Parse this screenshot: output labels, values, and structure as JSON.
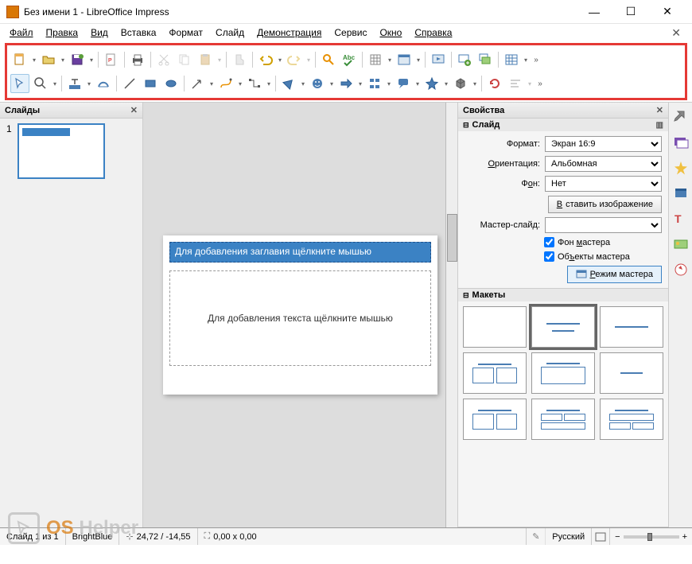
{
  "window": {
    "title": "Без имени 1 - LibreOffice Impress"
  },
  "menu": {
    "file": "Файл",
    "edit": "Правка",
    "view": "Вид",
    "insert": "Вставка",
    "format": "Формат",
    "slide": "Слайд",
    "show": "Демонстрация",
    "tools": "Сервис",
    "window": "Окно",
    "help": "Справка"
  },
  "panels": {
    "slides": "Слайды",
    "properties": "Свойства"
  },
  "slide_sections": {
    "slide": "Слайд",
    "layouts": "Макеты"
  },
  "slide_props": {
    "format_label": "Формат:",
    "format_value": "Экран 16:9",
    "orientation_label": "Ориентация:",
    "orientation_value": "Альбомная",
    "background_label": "Фон:",
    "background_value": "Нет",
    "insert_image": "Вставить изображение",
    "master_slide_label": "Мастер-слайд:",
    "master_slide_value": "",
    "master_bg": "Фон мастера",
    "master_objects": "Объекты мастера",
    "master_mode": "Режим мастера"
  },
  "placeholders": {
    "title": "Для добавления заглавия щёлкните мышью",
    "body": "Для добавления текста щёлкните мышью"
  },
  "thumb": {
    "index": "1"
  },
  "status": {
    "slide_of": "Слайд 1 из 1",
    "master": "BrightBlue",
    "pos": "24,72 / -14,55",
    "size": "0,00 x 0,00",
    "lang": "Русский"
  },
  "watermark": {
    "os": "OS",
    "helper": "Helper"
  }
}
